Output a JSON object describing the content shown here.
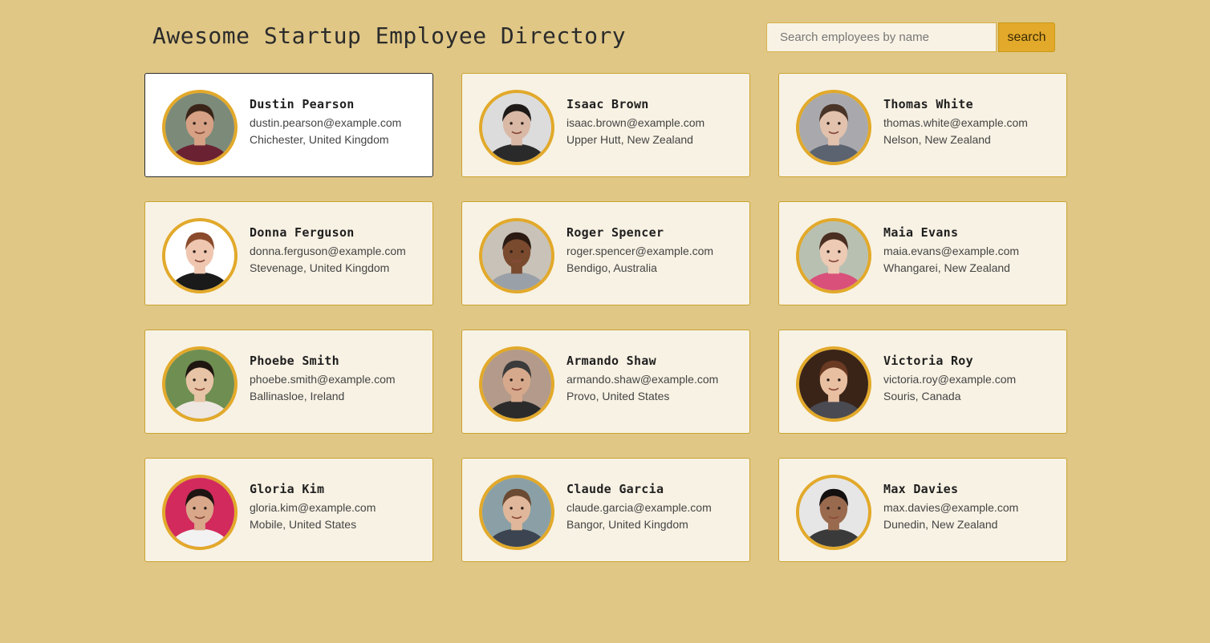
{
  "header": {
    "title": "Awesome Startup Employee Directory",
    "search_placeholder": "Search employees by name",
    "search_value": "",
    "search_button_label": "search"
  },
  "colors": {
    "page_background": "#e0c786",
    "card_background": "#f8f2e4",
    "card_border": "#c9a330",
    "selected_card_background": "#ffffff",
    "selected_card_border": "#2d2d2d",
    "avatar_ring": "#e2a92a",
    "search_button": "#e2a92a"
  },
  "employees": [
    {
      "name": "Dustin Pearson",
      "email": "dustin.pearson@example.com",
      "location": "Chichester, United Kingdom",
      "selected": true,
      "avatar": {
        "bg": "#7c8a7a",
        "skin": "#d6a184",
        "hair": "#3a2418",
        "shirt": "#6a2233"
      }
    },
    {
      "name": "Isaac Brown",
      "email": "isaac.brown@example.com",
      "location": "Upper Hutt, New Zealand",
      "selected": false,
      "avatar": {
        "bg": "#dcdcdc",
        "skin": "#d9b8a6",
        "hair": "#1e1a18",
        "shirt": "#2a2a2a"
      }
    },
    {
      "name": "Thomas White",
      "email": "thomas.white@example.com",
      "location": "Nelson, New Zealand",
      "selected": false,
      "avatar": {
        "bg": "#a9a9ad",
        "skin": "#e2c2ad",
        "hair": "#4a3428",
        "shirt": "#5b6270"
      }
    },
    {
      "name": "Donna Ferguson",
      "email": "donna.ferguson@example.com",
      "location": "Stevenage, United Kingdom",
      "selected": false,
      "avatar": {
        "bg": "#ffffff",
        "skin": "#efc7b1",
        "hair": "#8a4a2c",
        "shirt": "#1a1a1a"
      }
    },
    {
      "name": "Roger Spencer",
      "email": "roger.spencer@example.com",
      "location": "Bendigo, Australia",
      "selected": false,
      "avatar": {
        "bg": "#c8c2b8",
        "skin": "#7a4a2e",
        "hair": "#2a1a12",
        "shirt": "#9aa0a8"
      }
    },
    {
      "name": "Maia Evans",
      "email": "maia.evans@example.com",
      "location": "Whangarei, New Zealand",
      "selected": false,
      "avatar": {
        "bg": "#b8c0b2",
        "skin": "#eccab4",
        "hair": "#4a2e22",
        "shirt": "#d9507a"
      }
    },
    {
      "name": "Phoebe Smith",
      "email": "phoebe.smith@example.com",
      "location": "Ballinasloe, Ireland",
      "selected": false,
      "avatar": {
        "bg": "#6f8e52",
        "skin": "#e8c4a6",
        "hair": "#1f1612",
        "shirt": "#efe8e2"
      }
    },
    {
      "name": "Armando Shaw",
      "email": "armando.shaw@example.com",
      "location": "Provo, United States",
      "selected": false,
      "avatar": {
        "bg": "#b39a8a",
        "skin": "#d7a98c",
        "hair": "#3b3b3b",
        "shirt": "#2b2b2b"
      }
    },
    {
      "name": "Victoria Roy",
      "email": "victoria.roy@example.com",
      "location": "Souris, Canada",
      "selected": false,
      "avatar": {
        "bg": "#3a2418",
        "skin": "#e9bfa2",
        "hair": "#6a3a22",
        "shirt": "#4a4a52"
      }
    },
    {
      "name": "Gloria Kim",
      "email": "gloria.kim@example.com",
      "location": "Mobile, United States",
      "selected": false,
      "avatar": {
        "bg": "#d22a5c",
        "skin": "#d9a78a",
        "hair": "#1e1412",
        "shirt": "#f2f2f2"
      }
    },
    {
      "name": "Claude Garcia",
      "email": "claude.garcia@example.com",
      "location": "Bangor, United Kingdom",
      "selected": false,
      "avatar": {
        "bg": "#8aa0a6",
        "skin": "#e0b79a",
        "hair": "#6a4a32",
        "shirt": "#3b4450"
      }
    },
    {
      "name": "Max Davies",
      "email": "max.davies@example.com",
      "location": "Dunedin, New Zealand",
      "selected": false,
      "avatar": {
        "bg": "#e6e6e6",
        "skin": "#9a6a4e",
        "hair": "#141010",
        "shirt": "#3a3a3a"
      }
    }
  ]
}
